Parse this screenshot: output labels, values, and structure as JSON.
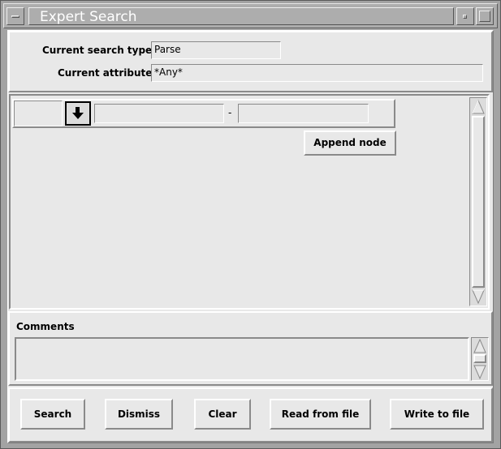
{
  "window": {
    "title": "Expert Search"
  },
  "search_info": {
    "type_label": "Current search type",
    "type_value": "Parse",
    "attribute_label": "Current attribute",
    "attribute_value": "*Any*"
  },
  "tree": {
    "range_separator": "-",
    "range_start": "",
    "range_end": "",
    "append_label": "Append node"
  },
  "comments": {
    "label": "Comments",
    "value": ""
  },
  "actions": {
    "search": "Search",
    "dismiss": "Dismiss",
    "clear": "Clear",
    "read": "Read from file",
    "write": "Write to file"
  },
  "icons": {
    "node_toggle": "down-arrow-icon",
    "scroll_up": "scroll-up-arrow-icon",
    "scroll_down": "scroll-down-arrow-icon"
  },
  "colors": {
    "title_text": "#ffffff",
    "panel_bg": "#e8e8e8",
    "frame_bg": "#a3a3a3"
  }
}
